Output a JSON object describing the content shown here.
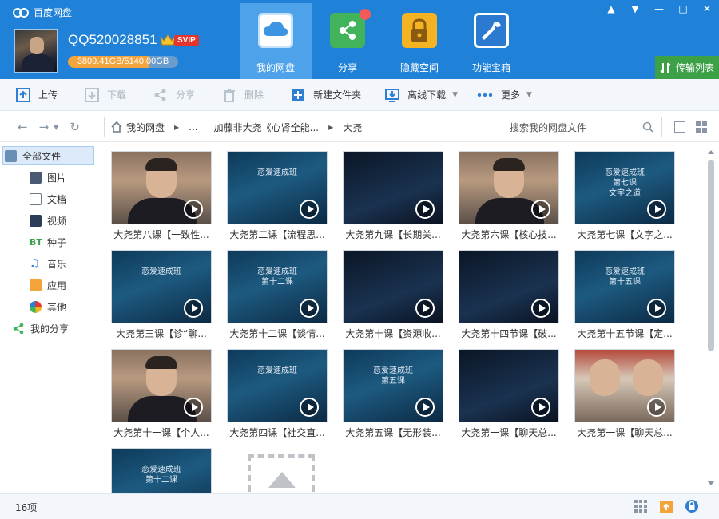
{
  "app": {
    "title": "百度网盘",
    "username": "QQ520028851",
    "vip_badge": "SVIP",
    "quota_text": "3809.41GB/5140.00GB",
    "quota_fraction": 0.741,
    "window_buttons": [
      "▲",
      "▼",
      "—",
      "□",
      "✕"
    ]
  },
  "nav": [
    {
      "label": "我的网盘",
      "icon": "cloud-icon",
      "active": true
    },
    {
      "label": "分享",
      "icon": "share-icon",
      "active": false
    },
    {
      "label": "隐藏空间",
      "icon": "lock-icon",
      "active": false
    },
    {
      "label": "功能宝箱",
      "icon": "wrench-icon",
      "active": false
    }
  ],
  "transfer_label": "传输列表",
  "toolbar": {
    "upload": "上传",
    "download": "下载",
    "share": "分享",
    "delete": "删除",
    "new_folder": "新建文件夹",
    "offline_download": "离线下载",
    "more": "更多"
  },
  "breadcrumb": {
    "root": "我的网盘",
    "ellipsis": "...",
    "parent": "加藤非大尧《心肾全能...",
    "current": "大尧"
  },
  "search_placeholder": "搜索我的网盘文件",
  "sidebar": {
    "all_files": "全部文件",
    "items": [
      {
        "label": "图片",
        "icon": "image-icon"
      },
      {
        "label": "文档",
        "icon": "document-icon"
      },
      {
        "label": "视频",
        "icon": "video-icon"
      },
      {
        "label": "种子",
        "icon": "bt-icon",
        "prefix": "BT"
      },
      {
        "label": "音乐",
        "icon": "music-icon"
      },
      {
        "label": "应用",
        "icon": "app-icon"
      },
      {
        "label": "其他",
        "icon": "other-icon"
      }
    ],
    "my_share": "我的分享"
  },
  "files": [
    {
      "name": "大尧第八课【一致性...",
      "thumb": "person"
    },
    {
      "name": "大尧第二课【流程思...",
      "thumb": "slide",
      "slide_text": "恋爱速成班"
    },
    {
      "name": "大尧第九课【长期关...",
      "thumb": "dark"
    },
    {
      "name": "大尧第六课【核心技...",
      "thumb": "person"
    },
    {
      "name": "大尧第七课【文字之...",
      "thumb": "slide",
      "slide_text": "恋爱速成班\n第七课\n文字之道"
    },
    {
      "name": "大尧第三课【诊“聊...",
      "thumb": "slide",
      "slide_text": "恋爱速成班"
    },
    {
      "name": "大尧第十二课【谈情...",
      "thumb": "slide",
      "slide_text": "恋爱速成班\n第十二课"
    },
    {
      "name": "大尧第十课【资源收...",
      "thumb": "dark"
    },
    {
      "name": "大尧第十四节课【破...",
      "thumb": "dark"
    },
    {
      "name": "大尧第十五节课【定...",
      "thumb": "slide",
      "slide_text": "恋爱速成班\n第十五课"
    },
    {
      "name": "大尧第十一课【个人...",
      "thumb": "person"
    },
    {
      "name": "大尧第四课【社交直...",
      "thumb": "slide",
      "slide_text": "恋爱速成班"
    },
    {
      "name": "大尧第五课【无形装...",
      "thumb": "slide",
      "slide_text": "恋爱速成班\n第五课"
    },
    {
      "name": "大尧第一课【聊天总...",
      "thumb": "dark"
    },
    {
      "name": "大尧第一课【聊天总...",
      "thumb": "pair"
    },
    {
      "name": "",
      "thumb": "slide",
      "slide_text": "恋爱速成班\n第十二课"
    }
  ],
  "status": {
    "count": "16项"
  }
}
